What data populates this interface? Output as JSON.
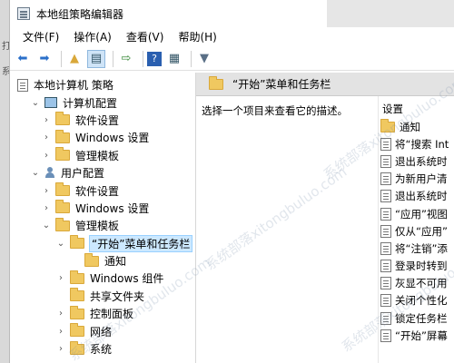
{
  "window": {
    "title": "本地组策略编辑器"
  },
  "background_strip": [
    "打",
    "系"
  ],
  "menu": [
    "文件(F)",
    "操作(A)",
    "查看(V)",
    "帮助(H)"
  ],
  "toolbar": {
    "icons": [
      "back-arrow-icon",
      "forward-arrow-icon",
      "up-folder-icon",
      "show-hide-tree-icon",
      "export-list-icon",
      "help-icon",
      "properties-icon",
      "filter-icon"
    ]
  },
  "tree": [
    {
      "label": "本地计算机 策略",
      "level": 0,
      "icon": "doc-icon",
      "chevron": ""
    },
    {
      "label": "计算机配置",
      "level": 1,
      "icon": "pc-icon",
      "chevron": "⌄"
    },
    {
      "label": "软件设置",
      "level": 2,
      "icon": "folder-icon",
      "chevron": "›"
    },
    {
      "label": "Windows 设置",
      "level": 2,
      "icon": "folder-icon",
      "chevron": "›"
    },
    {
      "label": "管理模板",
      "level": 2,
      "icon": "folder-icon",
      "chevron": "›"
    },
    {
      "label": "用户配置",
      "level": 1,
      "icon": "user-icon",
      "chevron": "⌄"
    },
    {
      "label": "软件设置",
      "level": 2,
      "icon": "folder-icon",
      "chevron": "›"
    },
    {
      "label": "Windows 设置",
      "level": 2,
      "icon": "folder-icon",
      "chevron": "›"
    },
    {
      "label": "管理模板",
      "level": 2,
      "icon": "folder-icon",
      "chevron": "⌄"
    },
    {
      "label": "“开始”菜单和任务栏",
      "level": 3,
      "icon": "folder-icon",
      "chevron": "⌄",
      "selected": true
    },
    {
      "label": "通知",
      "level": 4,
      "icon": "folder-icon",
      "chevron": ""
    },
    {
      "label": "Windows 组件",
      "level": 3,
      "icon": "folder-icon",
      "chevron": "›"
    },
    {
      "label": "共享文件夹",
      "level": 3,
      "icon": "folder-icon",
      "chevron": ""
    },
    {
      "label": "控制面板",
      "level": 3,
      "icon": "folder-icon",
      "chevron": "›"
    },
    {
      "label": "网络",
      "level": 3,
      "icon": "folder-icon",
      "chevron": "›"
    },
    {
      "label": "系统",
      "level": 3,
      "icon": "folder-icon",
      "chevron": "›"
    }
  ],
  "right_panel": {
    "header": "“开始”菜单和任务栏",
    "description": "选择一个项目来查看它的描述。",
    "list_header": "设置",
    "items": [
      {
        "label": "通知",
        "icon": "folder-icon"
      },
      {
        "label": "将“搜索 Int",
        "icon": "doc-icon"
      },
      {
        "label": "退出系统时",
        "icon": "doc-icon"
      },
      {
        "label": "为新用户清",
        "icon": "doc-icon"
      },
      {
        "label": "退出系统时",
        "icon": "doc-icon"
      },
      {
        "label": "“应用”视图",
        "icon": "doc-icon"
      },
      {
        "label": "仅从“应用”",
        "icon": "doc-icon"
      },
      {
        "label": "将“注销”添",
        "icon": "doc-icon"
      },
      {
        "label": "登录时转到",
        "icon": "doc-icon"
      },
      {
        "label": "灰显不可用",
        "icon": "doc-icon"
      },
      {
        "label": "关闭个性化",
        "icon": "doc-icon"
      },
      {
        "label": "锁定任务栏",
        "icon": "doc-icon"
      },
      {
        "label": "“开始”屏幕",
        "icon": "doc-icon"
      }
    ]
  },
  "watermark": "系统部落xitongbuluo.com"
}
